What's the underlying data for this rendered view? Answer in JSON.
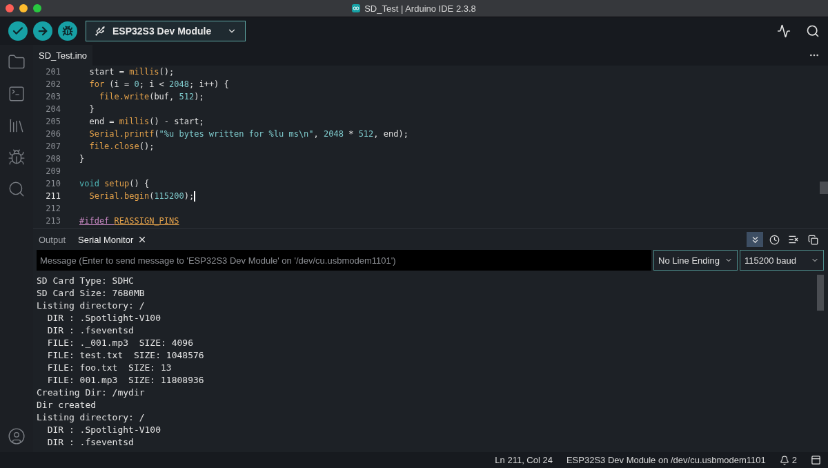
{
  "window": {
    "title": "SD_Test | Arduino IDE 2.3.8"
  },
  "toolbar": {
    "board": "ESP32S3 Dev Module"
  },
  "sidebar": {
    "items": [
      {
        "kind": "folder",
        "selected": false
      },
      {
        "kind": "boards",
        "selected": false
      },
      {
        "kind": "library",
        "selected": false
      },
      {
        "kind": "debug",
        "selected": false
      },
      {
        "kind": "search",
        "selected": false
      }
    ]
  },
  "editor": {
    "tabs": [
      {
        "label": "SD_Test.ino",
        "selected": true
      }
    ],
    "lines": [
      {
        "number": "201",
        "current": false,
        "tokens": [
          {
            "kind": "plain",
            "text": "  start = "
          },
          {
            "kind": "func",
            "text": "millis"
          },
          {
            "kind": "plain",
            "text": "();"
          }
        ]
      },
      {
        "number": "202",
        "current": false,
        "tokens": [
          {
            "kind": "func",
            "text": "  for"
          },
          {
            "kind": "plain",
            "text": " (i = "
          },
          {
            "kind": "number",
            "text": "0"
          },
          {
            "kind": "plain",
            "text": "; i < "
          },
          {
            "kind": "number",
            "text": "2048"
          },
          {
            "kind": "plain",
            "text": "; i++) {"
          }
        ]
      },
      {
        "number": "203",
        "current": false,
        "tokens": [
          {
            "kind": "func",
            "text": "    file.write"
          },
          {
            "kind": "plain",
            "text": "(buf, "
          },
          {
            "kind": "number",
            "text": "512"
          },
          {
            "kind": "plain",
            "text": ");"
          }
        ]
      },
      {
        "number": "204",
        "current": false,
        "tokens": [
          {
            "kind": "plain",
            "text": "  }"
          }
        ]
      },
      {
        "number": "205",
        "current": false,
        "tokens": [
          {
            "kind": "plain",
            "text": "  end = "
          },
          {
            "kind": "func",
            "text": "millis"
          },
          {
            "kind": "plain",
            "text": "() - start;"
          }
        ]
      },
      {
        "number": "206",
        "current": false,
        "tokens": [
          {
            "kind": "func",
            "text": "  Serial.printf"
          },
          {
            "kind": "plain",
            "text": "("
          },
          {
            "kind": "string",
            "text": "\"%u bytes written for %lu ms\\n\""
          },
          {
            "kind": "plain",
            "text": ", "
          },
          {
            "kind": "number",
            "text": "2048"
          },
          {
            "kind": "plain",
            "text": " * "
          },
          {
            "kind": "number",
            "text": "512"
          },
          {
            "kind": "plain",
            "text": ", end);"
          }
        ]
      },
      {
        "number": "207",
        "current": false,
        "tokens": [
          {
            "kind": "func",
            "text": "  file.close"
          },
          {
            "kind": "plain",
            "text": "();"
          }
        ]
      },
      {
        "number": "208",
        "current": false,
        "tokens": [
          {
            "kind": "plain",
            "text": "}"
          }
        ]
      },
      {
        "number": "209",
        "current": false
      },
      {
        "number": "210",
        "current": false,
        "tokens": [
          {
            "kind": "keyword",
            "text": "void"
          },
          {
            "kind": "func",
            "text": " setup"
          },
          {
            "kind": "plain",
            "text": "() {"
          }
        ]
      },
      {
        "number": "211",
        "current": true,
        "tokens": [
          {
            "kind": "func",
            "text": "  Serial.begin"
          },
          {
            "kind": "plain",
            "text": "("
          },
          {
            "kind": "number",
            "text": "115200"
          },
          {
            "kind": "plain",
            "text": ");"
          }
        ]
      },
      {
        "number": "212",
        "current": false
      },
      {
        "number": "213",
        "current": false,
        "tokens": [
          {
            "kind": "directive",
            "text": "#ifdef "
          },
          {
            "kind": "macro",
            "text": "REASSIGN_PINS"
          }
        ]
      }
    ]
  },
  "panel": {
    "tabs": [
      {
        "label": "Output",
        "selected": false,
        "closable": false
      },
      {
        "label": "Serial Monitor",
        "selected": true,
        "closable": true
      }
    ],
    "tools": [
      {
        "kind": "autoscroll",
        "on": true
      },
      {
        "kind": "timestamp",
        "on": false
      },
      {
        "kind": "clear",
        "on": false
      },
      {
        "kind": "copy",
        "on": false
      }
    ],
    "message": {
      "placeholder": "Message (Enter to send message to 'ESP32S3 Dev Module' on '/dev/cu.usbmodem1101')"
    },
    "line_ending": "No Line Ending",
    "baud": "115200 baud",
    "output": [
      "SD Card Type: SDHC",
      "SD Card Size: 7680MB",
      "Listing directory: /",
      "  DIR : .Spotlight-V100",
      "  DIR : .fseventsd",
      "  FILE: ._001.mp3  SIZE: 4096",
      "  FILE: test.txt  SIZE: 1048576",
      "  FILE: foo.txt  SIZE: 13",
      "  FILE: 001.mp3  SIZE: 11808936",
      "Creating Dir: /mydir",
      "Dir created",
      "Listing directory: /",
      "  DIR : .Spotlight-V100",
      "  DIR : .fseventsd"
    ]
  },
  "status_bar": {
    "position": "Ln 211, Col 24",
    "board": "ESP32S3 Dev Module on /dev/cu.usbmodem1101",
    "notifications": "2"
  }
}
